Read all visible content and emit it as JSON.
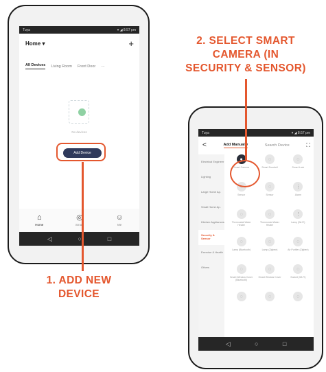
{
  "callouts": {
    "step1": "1. ADD NEW\nDEVICE",
    "step2": "2. SELECT SMART\nCAMERA (IN\nSECURITY & SENSOR)"
  },
  "phone1": {
    "status_left": "Tuya",
    "status_right": "▾ ◢ 8:57 pm",
    "title": "Home ▾",
    "plus": "+",
    "tabs": [
      "All Devices",
      "Living Room",
      "Front Door",
      "···"
    ],
    "empty_text": "No devices",
    "add_button": "Add Device",
    "bottom_tabs": [
      {
        "label": "Home",
        "icon": "home-icon",
        "glyph": "⌂"
      },
      {
        "label": "Smart",
        "icon": "smart-icon",
        "glyph": "◎"
      },
      {
        "label": "Me",
        "icon": "profile-icon",
        "glyph": "☺"
      }
    ],
    "nav": [
      "◁",
      "○",
      "□"
    ]
  },
  "phone2": {
    "status_left": "Tuya",
    "status_right": "▾ ◢ 8:57 pm",
    "back": "<",
    "title": "Add Manually",
    "search": "Search Device",
    "scan": "⛶",
    "categories": [
      "Electrical Engineer",
      "Lighting",
      "Large Home Ap.",
      "Small Home Ap.",
      "Kitchen Appliances",
      "Security & Sensor",
      "Exercise & Health",
      "Others"
    ],
    "active_category": 5,
    "devices": [
      {
        "label": "Smart Camera",
        "glyph": "●"
      },
      {
        "label": "Smart Doorbell",
        "glyph": "◌"
      },
      {
        "label": "Smart Lock",
        "glyph": "◌"
      },
      {
        "label": "Sensor",
        "glyph": "◌"
      },
      {
        "label": "Sensor",
        "glyph": "◌"
      },
      {
        "label": "Alarm",
        "glyph": "⋮"
      },
      {
        "label": "Thermostat Water Heater",
        "glyph": "◌"
      },
      {
        "label": "Thermostat Water Heater",
        "glyph": "◌"
      },
      {
        "label": "Lamp (Wi-Fi)",
        "glyph": "⋮"
      },
      {
        "label": "Lamp (Bluetooth)",
        "glyph": "◌"
      },
      {
        "label": "Lamp (Zigbee)",
        "glyph": "◌"
      },
      {
        "label": "Air Purifier (Zigbee)",
        "glyph": "◌"
      },
      {
        "label": "Smart Window Cover (Bluetooth)",
        "glyph": "◌"
      },
      {
        "label": "Smart Window Cover",
        "glyph": "◌"
      },
      {
        "label": "Socket (Wi-Fi)",
        "glyph": "◌"
      },
      {
        "label": "",
        "glyph": "◌"
      },
      {
        "label": "",
        "glyph": "◌"
      },
      {
        "label": "",
        "glyph": "◌"
      }
    ],
    "nav": [
      "◁",
      "○",
      "□"
    ]
  },
  "colors": {
    "accent": "#e4572e",
    "button_dark": "#2f3a5c"
  }
}
